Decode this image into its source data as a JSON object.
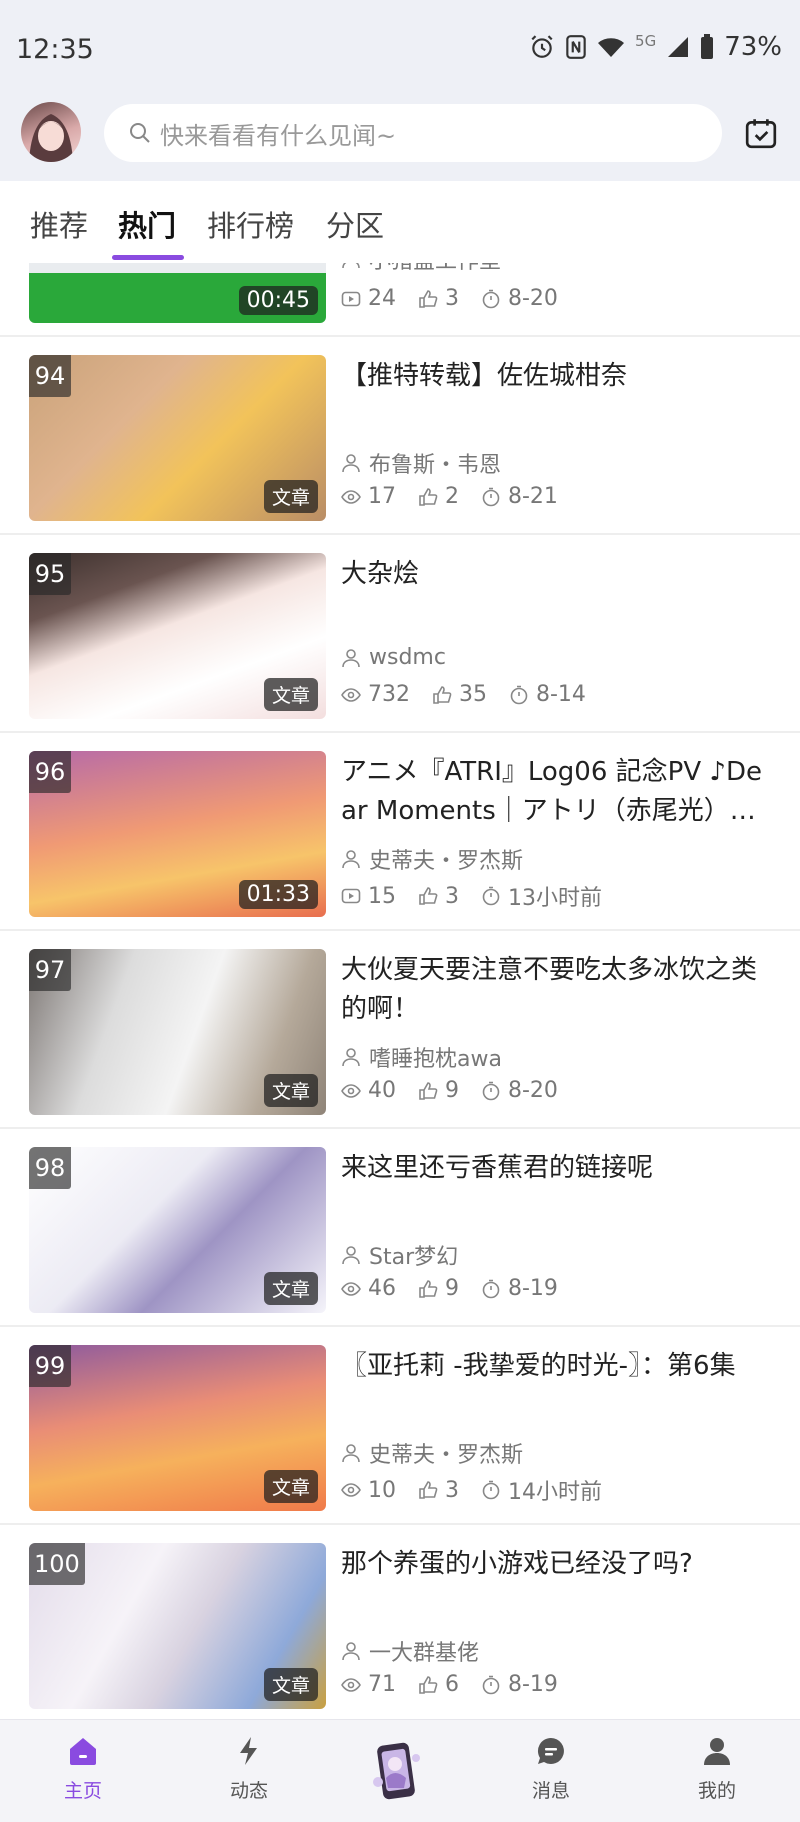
{
  "status": {
    "time": "12:35",
    "network": "5G",
    "battery": "73%"
  },
  "search": {
    "placeholder": "快来看看有什么见闻~"
  },
  "tabs": [
    {
      "label": "推荐"
    },
    {
      "label": "热门"
    },
    {
      "label": "排行榜"
    },
    {
      "label": "分区"
    }
  ],
  "partial_item": {
    "author": "小猪盒工作室",
    "views": "24",
    "likes": "3",
    "date": "8-20",
    "duration": "00:45"
  },
  "items": [
    {
      "rank": "94",
      "title": "【推特转载】佐佐城柑奈",
      "author": "布鲁斯・韦恩",
      "views": "17",
      "likes": "2",
      "date": "8-21",
      "badge": "文章",
      "kind": "article"
    },
    {
      "rank": "95",
      "title": "大杂烩",
      "author": "wsdmc",
      "views": "732",
      "likes": "35",
      "date": "8-14",
      "badge": "文章",
      "kind": "article"
    },
    {
      "rank": "96",
      "title": "アニメ『ATRI』Log06 記念PV ♪Dear Moments｜アトリ（赤尾光）【A…",
      "author": "史蒂夫・罗杰斯",
      "views": "15",
      "likes": "3",
      "date": "13小时前",
      "badge": "01:33",
      "kind": "video"
    },
    {
      "rank": "97",
      "title": "大伙夏天要注意不要吃太多冰饮之类的啊！",
      "author": "嗜睡抱枕awa",
      "views": "40",
      "likes": "9",
      "date": "8-20",
      "badge": "文章",
      "kind": "article"
    },
    {
      "rank": "98",
      "title": "来这里还亏香蕉君的链接呢",
      "author": "Star梦幻",
      "views": "46",
      "likes": "9",
      "date": "8-19",
      "badge": "文章",
      "kind": "article"
    },
    {
      "rank": "99",
      "title": "〖亚托莉 -我挚爱的时光-〗：第6集",
      "author": "史蒂夫・罗杰斯",
      "views": "10",
      "likes": "3",
      "date": "14小时前",
      "badge": "文章",
      "kind": "article"
    },
    {
      "rank": "100",
      "title": "那个养蛋的小游戏已经没了吗?",
      "author": "一大群基佬",
      "views": "71",
      "likes": "6",
      "date": "8-19",
      "badge": "文章",
      "kind": "article"
    }
  ],
  "nav": [
    {
      "label": "主页"
    },
    {
      "label": "动态"
    },
    {
      "label": "消息"
    },
    {
      "label": "我的"
    }
  ],
  "colors": {
    "accent": "#8a4be0",
    "header_bg": "#eef0f6"
  }
}
